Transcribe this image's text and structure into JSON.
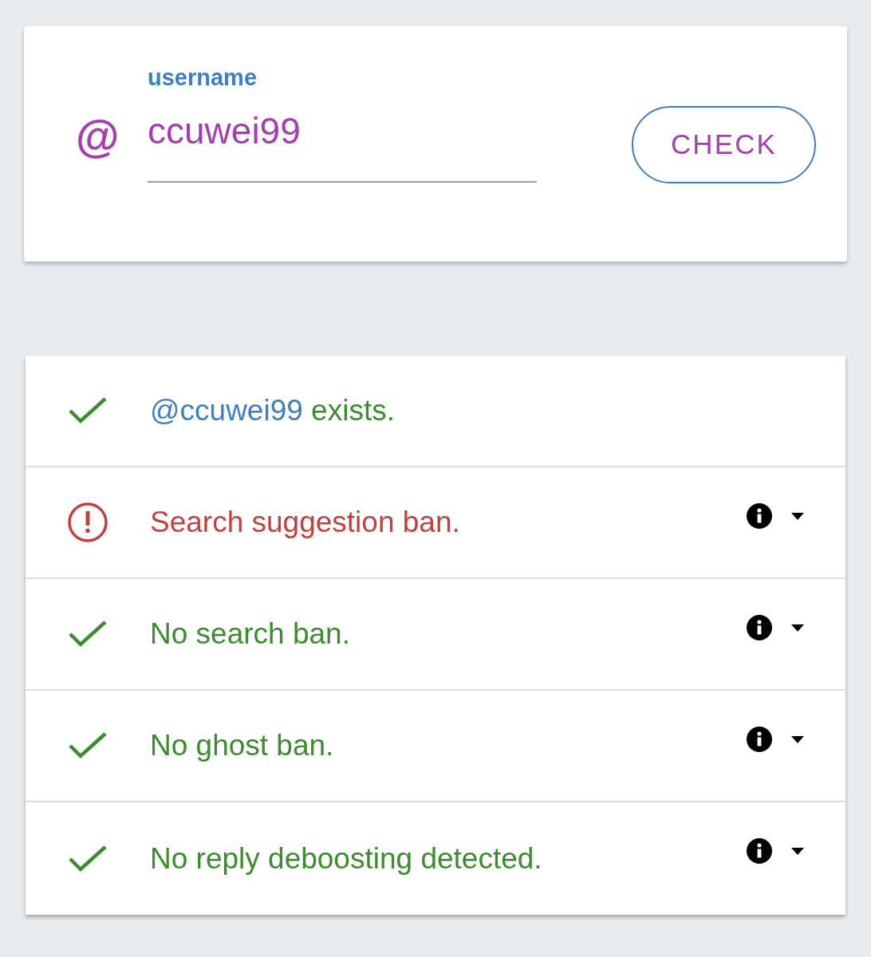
{
  "search_card": {
    "prefix_icon": "@",
    "field": {
      "label": "username",
      "value": "ccuwei99"
    },
    "button": "CHECK"
  },
  "results": [
    {
      "kind": "ok",
      "handle": "@ccuwei99",
      "text": "exists.",
      "details": false
    },
    {
      "kind": "ban",
      "text": "Search suggestion ban.",
      "details": true,
      "expanded": false
    },
    {
      "kind": "ok",
      "text": "No search ban.",
      "details": true,
      "expanded": false
    },
    {
      "kind": "ok",
      "text": "No ghost ban.",
      "details": true,
      "expanded": false
    },
    {
      "kind": "ok",
      "text": "No reply deboosting detected.",
      "details": true,
      "expanded": false
    }
  ]
}
